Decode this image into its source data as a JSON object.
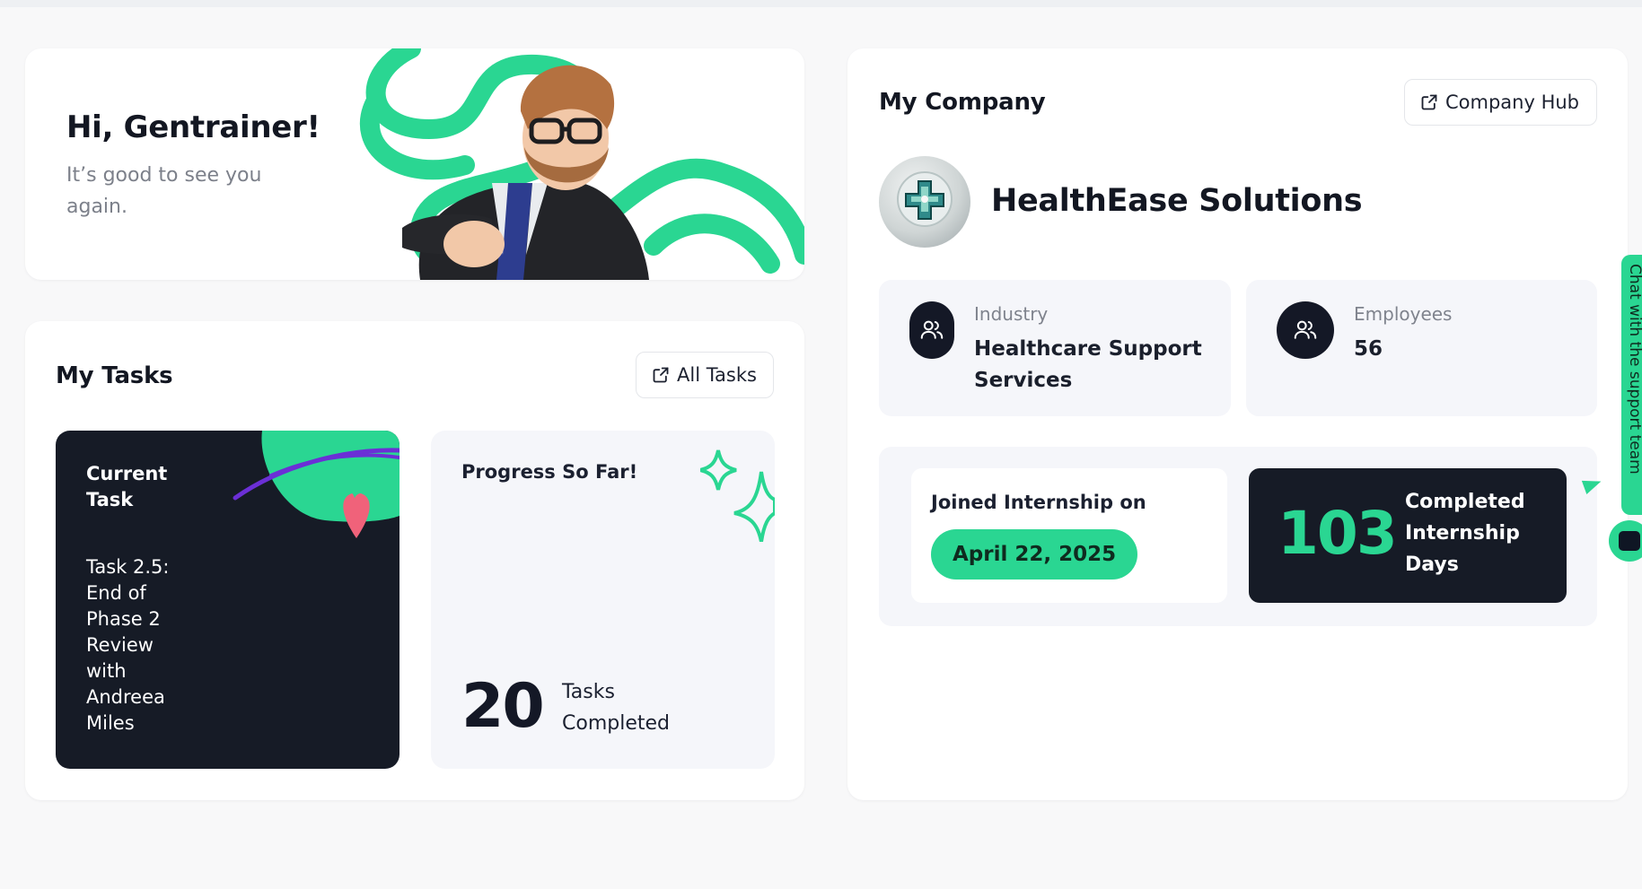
{
  "greeting": {
    "title": "Hi, Gentrainer!",
    "subtitle": "It’s good to see you again."
  },
  "tasks": {
    "title": "My Tasks",
    "all_tasks_label": "All Tasks",
    "current": {
      "label": "Current Task",
      "name": "Task 2.5: End of Phase 2 Review with Andreea Miles"
    },
    "progress": {
      "label": "Progress So Far!",
      "count": "20",
      "unit": "Tasks Completed"
    }
  },
  "company": {
    "title": "My Company",
    "hub_label": "Company Hub",
    "name": "HealthEase Solutions",
    "industry_label": "Industry",
    "industry_value": "Healthcare Support Services",
    "employees_label": "Employees",
    "employees_value": "56",
    "joined_label": "Joined Internship on",
    "joined_date": "April 22, 2025",
    "days_count": "103",
    "days_unit": "Completed Internship Days"
  },
  "support": {
    "chat_tab_label": "Chat with the support team"
  },
  "colors": {
    "accent": "#2ad692",
    "dark": "#161b26",
    "purple": "#6b2fd6",
    "pink": "#f0627a"
  },
  "icons": {
    "external_link": "external-link-icon",
    "users": "users-icon",
    "chat": "chat-bubble-icon"
  }
}
